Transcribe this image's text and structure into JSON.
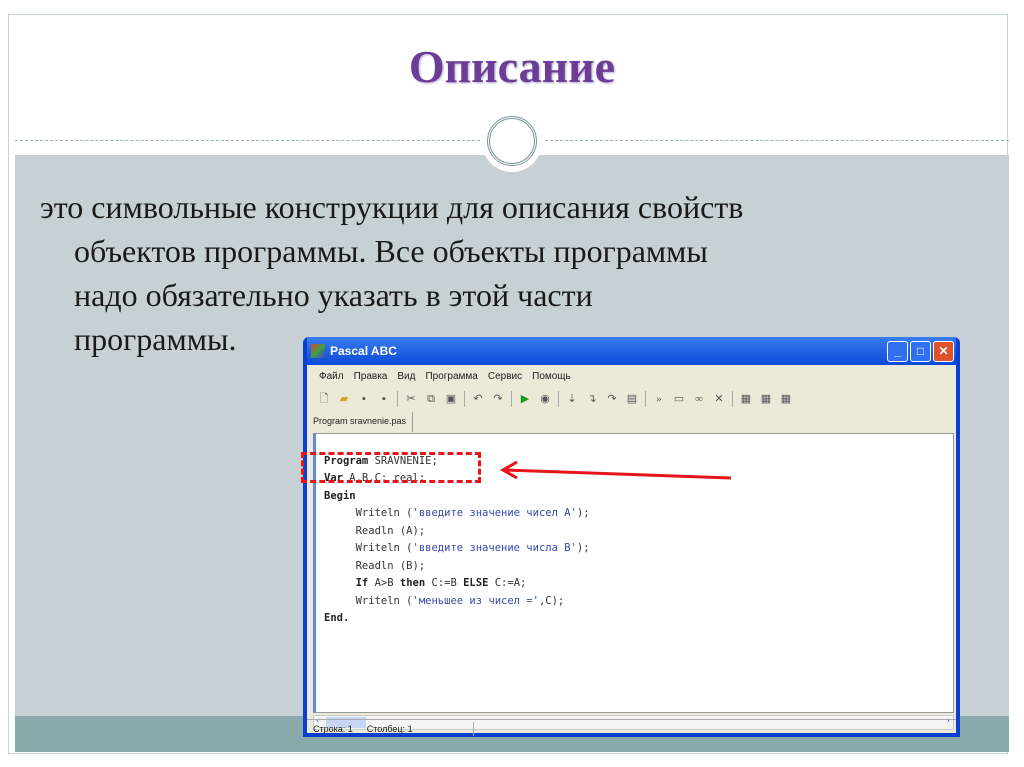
{
  "slide": {
    "title": "Описание",
    "body_lines": [
      "это символьные конструкции для описания свойств",
      "объектов программы. Все объекты программы",
      "надо обязательно указать в этой части",
      "программы."
    ]
  },
  "window": {
    "title": "Pascal ABC",
    "menu": [
      "Файл",
      "Правка",
      "Вид",
      "Программа",
      "Сервис",
      "Помощь"
    ],
    "tab": "Program sravnenie.pas",
    "code": [
      {
        "kw": "Program",
        "rest": " SRAVNENIE;"
      },
      {
        "kw": "Var",
        "rest": " A,B,C: real;"
      },
      {
        "kw": "Begin",
        "rest": ""
      }
    ],
    "code_body": [
      {
        "pre": "     Writeln (",
        "str": "'введите значение чисел A'",
        "post": ");"
      },
      {
        "pre": "     Readln (A);",
        "str": "",
        "post": ""
      },
      {
        "pre": "     Writeln (",
        "str": "'введите значение числа B'",
        "post": ");"
      },
      {
        "pre": "     Readln (B);",
        "str": "",
        "post": ""
      },
      {
        "pre": "     Writeln (",
        "str": "'меньшее из чисел ='",
        "post": ",C);"
      }
    ],
    "if_line": {
      "a": "If",
      "b": " A>B ",
      "c": "then",
      "d": " C:=B ",
      "e": "ELSE",
      "f": " C:=A;"
    },
    "end": "End.",
    "status": {
      "row": "Строка: 1",
      "col": "Столбец: 1"
    }
  },
  "colors": {
    "title": "#6a3d96",
    "highlight": "#e8141a",
    "body_bg": "#c6d0d5",
    "band": "#89aaaa"
  }
}
